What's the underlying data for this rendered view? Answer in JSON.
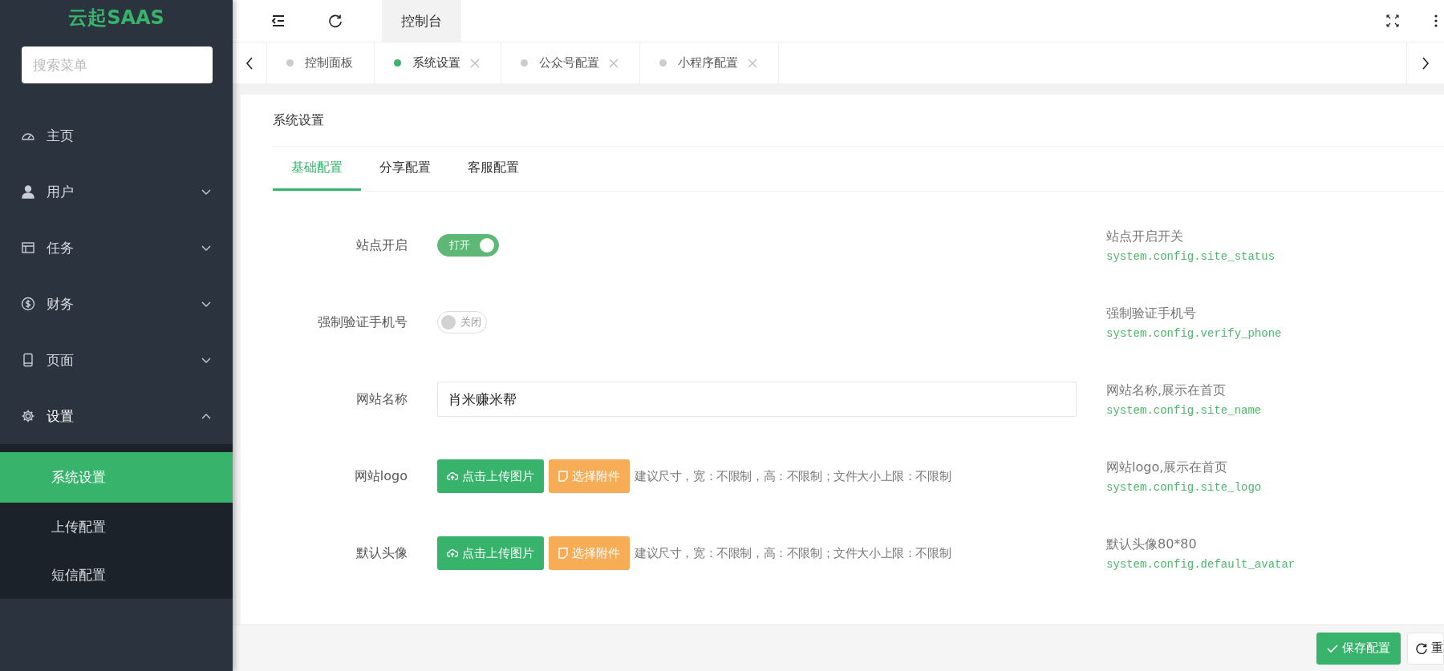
{
  "sidebar": {
    "logo": "云起SAAS",
    "search": {
      "placeholder": "搜索菜单"
    },
    "items": [
      {
        "label": "主页"
      },
      {
        "label": "用户",
        "expanded": false
      },
      {
        "label": "任务",
        "expanded": false
      },
      {
        "label": "财务",
        "expanded": false
      },
      {
        "label": "页面",
        "expanded": false
      },
      {
        "label": "设置",
        "expanded": true,
        "children": [
          {
            "label": "系统设置",
            "selected": true
          },
          {
            "label": "上传配置",
            "selected": false
          },
          {
            "label": "短信配置",
            "selected": false
          }
        ]
      }
    ]
  },
  "topbar": {
    "tab": "控制台"
  },
  "page_tabs": [
    {
      "label": "控制面板",
      "selected": false,
      "closable": false
    },
    {
      "label": "系统设置",
      "selected": true,
      "closable": true
    },
    {
      "label": "公众号配置",
      "selected": false,
      "closable": true
    },
    {
      "label": "小程序配置",
      "selected": false,
      "closable": true
    }
  ],
  "card": {
    "title": "系统设置",
    "tabs": [
      {
        "label": "基础配置",
        "selected": true
      },
      {
        "label": "分享配置",
        "selected": false
      },
      {
        "label": "客服配置",
        "selected": false
      }
    ],
    "fields": [
      {
        "kind": "switch",
        "label": "站点开启",
        "on": true,
        "switch_text": "打开",
        "description": "站点开启开关",
        "key": "system.config.site_status"
      },
      {
        "kind": "switch",
        "label": "强制验证手机号",
        "on": false,
        "switch_text": "关闭",
        "description": "强制验证手机号",
        "key": "system.config.verify_phone"
      },
      {
        "kind": "text",
        "label": "网站名称",
        "value": "肖米赚米帮",
        "description": "网站名称,展示在首页",
        "key": "system.config.site_name"
      },
      {
        "kind": "upload",
        "label": "网站logo",
        "upload_label": "点击上传图片",
        "attach_label": "选择附件",
        "hint": "建议尺寸，宽：不限制，高：不限制；文件大小上限：不限制",
        "description": "网站logo,展示在首页",
        "key": "system.config.site_logo"
      },
      {
        "kind": "upload",
        "label": "默认头像",
        "upload_label": "点击上传图片",
        "attach_label": "选择附件",
        "hint": "建议尺寸，宽：不限制，高：不限制；文件大小上限：不限制",
        "description": "默认头像80*80",
        "key": "system.config.default_avatar"
      }
    ]
  },
  "footer": {
    "buttons": [
      {
        "label": "保存配置",
        "kind": "primary"
      },
      {
        "label": "重",
        "kind": "default"
      }
    ]
  }
}
